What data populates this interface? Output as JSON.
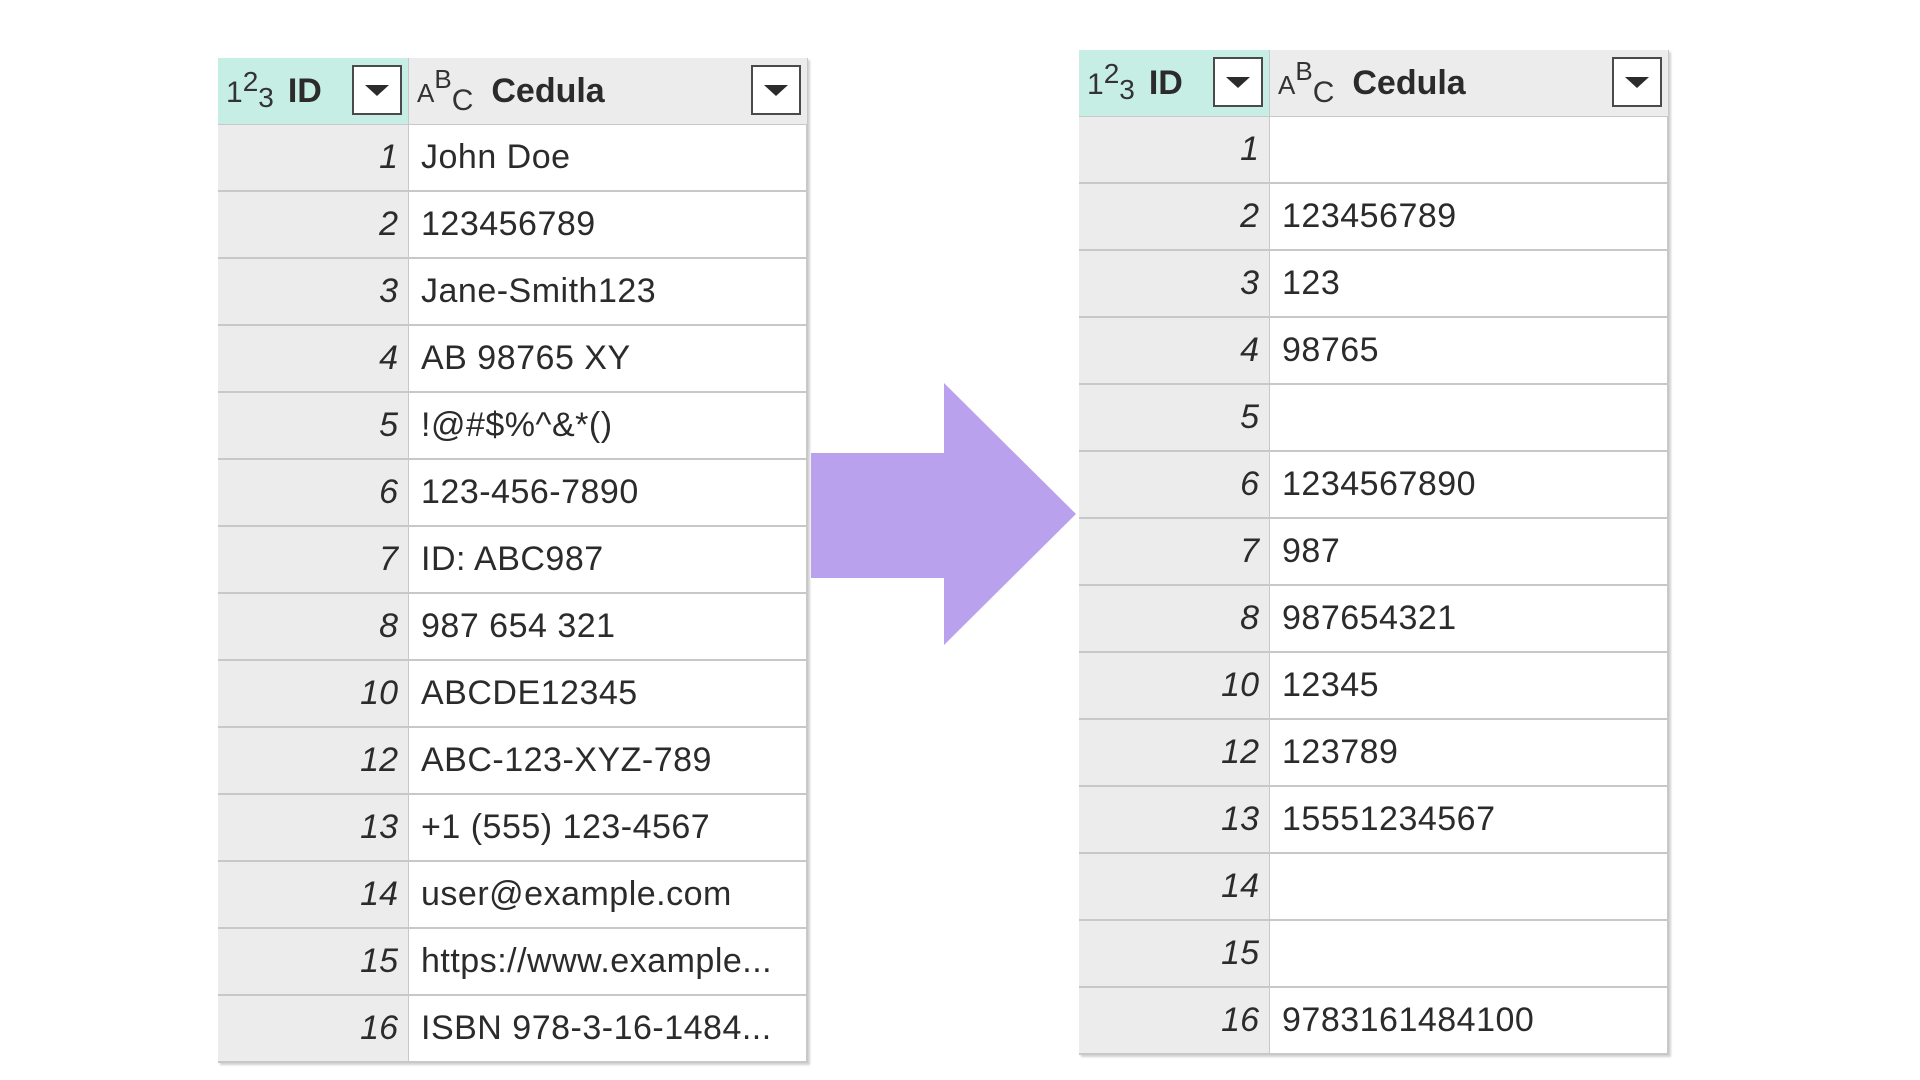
{
  "left_table": {
    "headers": {
      "id": "ID",
      "cedula": "Cedula"
    },
    "type_icons": {
      "id": "number-type-icon",
      "cedula": "text-type-icon"
    },
    "rows": [
      {
        "id": "1",
        "value": "John Doe"
      },
      {
        "id": "2",
        "value": "123456789"
      },
      {
        "id": "3",
        "value": "Jane-Smith123"
      },
      {
        "id": "4",
        "value": "AB 98765 XY"
      },
      {
        "id": "5",
        "value": "!@#$%^&*()"
      },
      {
        "id": "6",
        "value": "123-456-7890"
      },
      {
        "id": "7",
        "value": "ID: ABC987"
      },
      {
        "id": "8",
        "value": "987 654 321"
      },
      {
        "id": "10",
        "value": "ABCDE12345"
      },
      {
        "id": "12",
        "value": "ABC-123-XYZ-789"
      },
      {
        "id": "13",
        "value": "+1 (555) 123-4567"
      },
      {
        "id": "14",
        "value": "user@example.com"
      },
      {
        "id": "15",
        "value": "https://www.example..."
      },
      {
        "id": "16",
        "value": "ISBN 978-3-16-1484..."
      }
    ]
  },
  "right_table": {
    "headers": {
      "id": "ID",
      "cedula": "Cedula"
    },
    "type_icons": {
      "id": "number-type-icon",
      "cedula": "text-type-icon"
    },
    "rows": [
      {
        "id": "1",
        "value": ""
      },
      {
        "id": "2",
        "value": "123456789"
      },
      {
        "id": "3",
        "value": "123"
      },
      {
        "id": "4",
        "value": "98765"
      },
      {
        "id": "5",
        "value": ""
      },
      {
        "id": "6",
        "value": "1234567890"
      },
      {
        "id": "7",
        "value": "987"
      },
      {
        "id": "8",
        "value": "987654321"
      },
      {
        "id": "10",
        "value": "12345"
      },
      {
        "id": "12",
        "value": "123789"
      },
      {
        "id": "13",
        "value": "15551234567"
      },
      {
        "id": "14",
        "value": ""
      },
      {
        "id": "15",
        "value": ""
      },
      {
        "id": "16",
        "value": "9783161484100"
      }
    ]
  },
  "arrow": {
    "icon": "right-arrow-icon",
    "color": "#b9a1ee"
  },
  "colors": {
    "id_header_bg": "#c6eee4",
    "header_bg": "#ececec",
    "id_cell_bg": "#ececec",
    "grid_line": "#c8c8c8",
    "text": "#2b2b2b"
  }
}
